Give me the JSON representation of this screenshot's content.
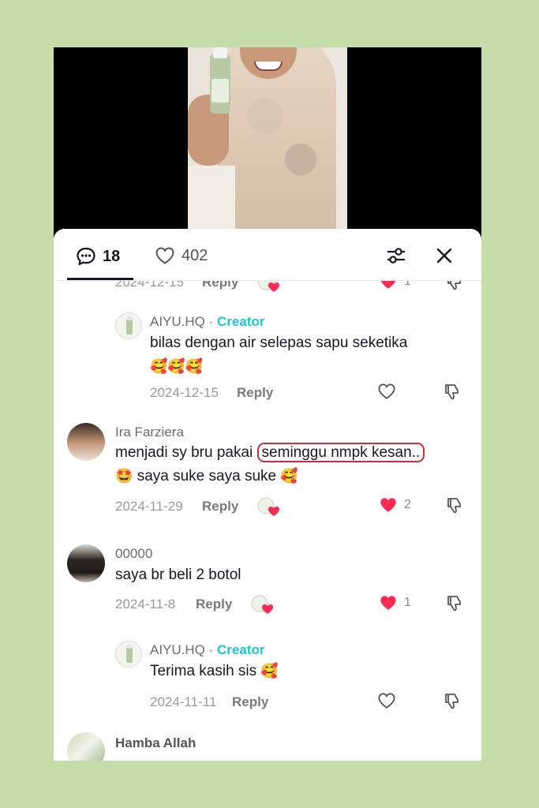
{
  "header": {
    "comment_count": "18",
    "like_count": "402"
  },
  "colors": {
    "background": "#c5dcab",
    "creator": "#20c5d4",
    "like_red": "#fe2c55",
    "highlight_border": "#c8303a"
  },
  "comments": [
    {
      "id": "c0",
      "date": "2024-12-15",
      "reply": "Reply",
      "likes": "1"
    },
    {
      "id": "c1",
      "user": "AIYU.HQ",
      "separator": " · ",
      "badge": "Creator",
      "text": "bilas dengan air selepas sapu seketika",
      "emojis": "🥰🥰🥰",
      "date": "2024-12-15",
      "reply": "Reply"
    },
    {
      "id": "c2",
      "user": "Ira Farziera",
      "text_a": "menjadi sy bru pakai ",
      "text_highlight": "seminggu nmpk kesan..",
      "text_b": " saya suke saya suke ",
      "emoji_a": "🤩",
      "emoji_b": "🥰",
      "date": "2024-11-29",
      "reply": "Reply",
      "likes": "2"
    },
    {
      "id": "c3",
      "user": "00000",
      "text": "saya br beli 2 botol",
      "date": "2024-11-8",
      "reply": "Reply",
      "likes": "1"
    },
    {
      "id": "c4",
      "user": "AIYU.HQ",
      "separator": " · ",
      "badge": "Creator",
      "text": "Terima kasih sis ",
      "emoji": "🥰",
      "date": "2024-11-11",
      "reply": "Reply"
    },
    {
      "id": "c5",
      "user": "Hamba Allah"
    }
  ],
  "icons": {
    "comment": "comment-bubble-icon",
    "like": "heart-outline-icon",
    "filter": "sliders-icon",
    "close": "close-icon",
    "dislike": "thumbs-down-icon",
    "liked": "heart-filled-icon"
  }
}
